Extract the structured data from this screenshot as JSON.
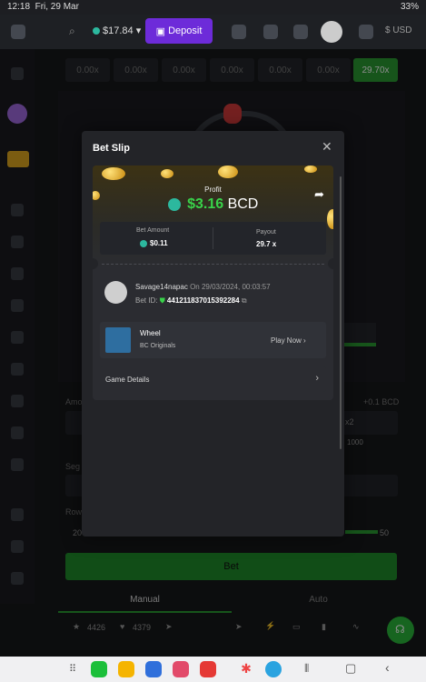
{
  "status_bar": {
    "time": "12:18",
    "date": "Fri, 29 Mar",
    "battery": "33%"
  },
  "header": {
    "balance": "$17.84",
    "deposit_label": "Deposit",
    "currency": "$ USD"
  },
  "multipliers": [
    "0.00x",
    "0.00x",
    "0.00x",
    "0.00x",
    "0.00x",
    "0.00x",
    "29.70x"
  ],
  "background": {
    "amount_label": "Amo",
    "amount_hint": "+0.1 BCD",
    "segments_label": "Seg",
    "rows_label": "Row",
    "rows_min": "20",
    "rows_max": "50",
    "x2_label": "x2",
    "max_label": "1000",
    "bet_label": "Bet",
    "tab_manual": "Manual",
    "tab_auto": "Auto",
    "likes": "4426",
    "favs": "4379"
  },
  "modal": {
    "title": "Bet Slip",
    "profit_label": "Profit",
    "profit_value": "$3.16",
    "profit_currency": "BCD",
    "bet_amount_label": "Bet Amount",
    "bet_amount_value": "$0.11",
    "payout_label": "Payout",
    "payout_value": "29.7 x",
    "username": "Savage14napac",
    "date_text": "On 29/03/2024, 00:03:57",
    "bet_id_label": "Bet ID:",
    "bet_id": "441211837015392284",
    "game_name": "Wheel",
    "game_provider": "BC Originals",
    "play_now": "Play Now",
    "game_details": "Game Details"
  },
  "colors": {
    "accent_green": "#39d24a",
    "deposit_purple": "#6d2bd9",
    "bet_green": "#1f8c2a"
  }
}
